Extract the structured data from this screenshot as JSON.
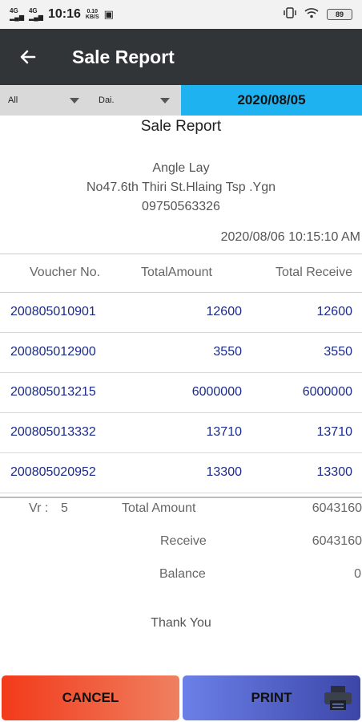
{
  "status_bar": {
    "signal1": "4G",
    "signal2": "4G",
    "time": "10:16",
    "speed_value": "0.10",
    "speed_unit": "KB/S",
    "battery": "89"
  },
  "app_bar": {
    "title": "Sale Report"
  },
  "filters": {
    "filter1": "All",
    "filter2": "Dai.",
    "date": "2020/08/05"
  },
  "report": {
    "title": "Sale Report",
    "shop_name": "Angle Lay",
    "address": "No47.6th Thiri St.Hlaing Tsp .Ygn",
    "phone": "09750563326",
    "datetime": "2020/08/06  10:15:10 AM"
  },
  "table": {
    "headers": [
      "Voucher No.",
      "TotalAmount",
      "Total Receive"
    ],
    "rows": [
      [
        "200805010901",
        "12600",
        "12600"
      ],
      [
        "200805012900",
        "3550",
        "3550"
      ],
      [
        "200805013215",
        "6000000",
        "6000000"
      ],
      [
        "200805013332",
        "13710",
        "13710"
      ],
      [
        "200805020952",
        "13300",
        "13300"
      ]
    ]
  },
  "summary": {
    "vr_label": "Vr :",
    "vr_count": "5",
    "total_label": "Total Amount",
    "total_value": "6043160",
    "receive_label": "Receive",
    "receive_value": "6043160",
    "balance_label": "Balance",
    "balance_value": "0"
  },
  "footer_text": "Thank You",
  "buttons": {
    "cancel": "CANCEL",
    "print": "PRINT"
  },
  "colors": {
    "app_bar": "#323538",
    "date_highlight": "#1eb3f0",
    "row_text": "#1a2a8a",
    "cancel_start": "#f23a1a",
    "print_end": "#3c46a8"
  },
  "icons": [
    "back-arrow-icon",
    "printer-icon",
    "vibrate-icon",
    "wifi-icon",
    "battery-icon"
  ]
}
